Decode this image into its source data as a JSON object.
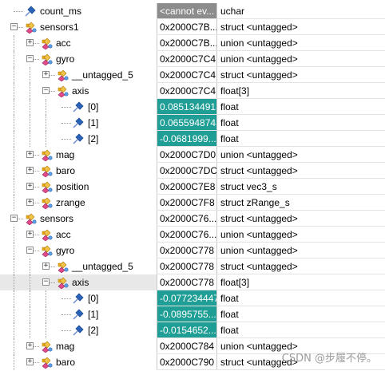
{
  "rows": [
    {
      "depth": 0,
      "expander": "",
      "icon": "pin-icon",
      "name": "count_ms",
      "value": "<cannot ev...",
      "type": "uchar",
      "value_style": "gray"
    },
    {
      "depth": 0,
      "expander": "-",
      "icon": "struct-icon",
      "name": "sensors1",
      "value": "0x2000C7B...",
      "type": "struct <untagged>"
    },
    {
      "depth": 1,
      "expander": "+",
      "icon": "struct-icon",
      "name": "acc",
      "value": "0x2000C7B...",
      "type": "union <untagged>"
    },
    {
      "depth": 1,
      "expander": "-",
      "icon": "struct-icon",
      "name": "gyro",
      "value": "0x2000C7C4",
      "type": "union <untagged>"
    },
    {
      "depth": 2,
      "expander": "+",
      "icon": "struct-icon",
      "name": "__untagged_5",
      "value": "0x2000C7C4",
      "type": "struct <untagged>"
    },
    {
      "depth": 2,
      "expander": "-",
      "icon": "struct-icon",
      "name": "axis",
      "value": "0x2000C7C4",
      "type": "float[3]"
    },
    {
      "depth": 3,
      "expander": "",
      "icon": "pin-icon",
      "name": "[0]",
      "value": "0.0851344913",
      "type": "float",
      "value_style": "hl"
    },
    {
      "depth": 3,
      "expander": "",
      "icon": "pin-icon",
      "name": "[1]",
      "value": "0.0655948743",
      "type": "float",
      "value_style": "hl"
    },
    {
      "depth": 3,
      "expander": "",
      "icon": "pin-icon",
      "name": "[2]",
      "value": "-0.0681999...",
      "type": "float",
      "value_style": "hl"
    },
    {
      "depth": 1,
      "expander": "+",
      "icon": "struct-icon",
      "name": "mag",
      "value": "0x2000C7D0",
      "type": "union <untagged>"
    },
    {
      "depth": 1,
      "expander": "+",
      "icon": "struct-icon",
      "name": "baro",
      "value": "0x2000C7DC",
      "type": "struct <untagged>"
    },
    {
      "depth": 1,
      "expander": "+",
      "icon": "struct-icon",
      "name": "position",
      "value": "0x2000C7E8",
      "type": "struct vec3_s"
    },
    {
      "depth": 1,
      "expander": "+",
      "icon": "struct-icon",
      "name": "zrange",
      "value": "0x2000C7F8",
      "type": "struct zRange_s"
    },
    {
      "depth": 0,
      "expander": "-",
      "icon": "struct-icon",
      "name": "sensors",
      "value": "0x2000C76...",
      "type": "struct <untagged>"
    },
    {
      "depth": 1,
      "expander": "+",
      "icon": "struct-icon",
      "name": "acc",
      "value": "0x2000C76...",
      "type": "union <untagged>"
    },
    {
      "depth": 1,
      "expander": "-",
      "icon": "struct-icon",
      "name": "gyro",
      "value": "0x2000C778",
      "type": "union <untagged>"
    },
    {
      "depth": 2,
      "expander": "+",
      "icon": "struct-icon",
      "name": "__untagged_5",
      "value": "0x2000C778",
      "type": "struct <untagged>"
    },
    {
      "depth": 2,
      "expander": "-",
      "icon": "struct-icon",
      "name": "axis",
      "value": "0x2000C778",
      "type": "float[3]",
      "selected": true
    },
    {
      "depth": 3,
      "expander": "",
      "icon": "pin-icon",
      "name": "[0]",
      "value": "-0.077234447",
      "type": "float",
      "value_style": "hl"
    },
    {
      "depth": 3,
      "expander": "",
      "icon": "pin-icon",
      "name": "[1]",
      "value": "-0.0895755...",
      "type": "float",
      "value_style": "hl"
    },
    {
      "depth": 3,
      "expander": "",
      "icon": "pin-icon",
      "name": "[2]",
      "value": "-0.0154652...",
      "type": "float",
      "value_style": "hl"
    },
    {
      "depth": 1,
      "expander": "+",
      "icon": "struct-icon",
      "name": "mag",
      "value": "0x2000C784",
      "type": "union <untagged>"
    },
    {
      "depth": 1,
      "expander": "+",
      "icon": "struct-icon",
      "name": "baro",
      "value": "0x2000C790",
      "type": "struct <untagged>"
    }
  ],
  "watermark": "CSDN @步履不停。",
  "colors": {
    "highlight": "#1e9e95",
    "header_gray": "#8c8c8c",
    "diamond_blue": "#2a63b8"
  }
}
